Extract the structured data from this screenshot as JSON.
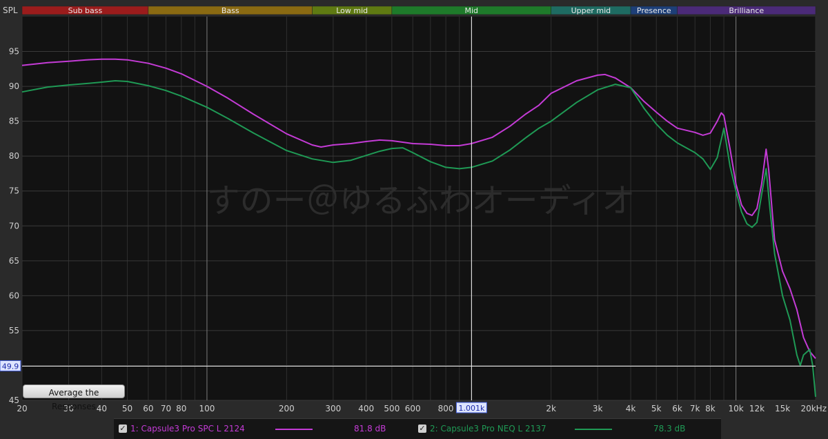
{
  "bands": [
    {
      "label": "Sub bass",
      "color": "#9b1c1c",
      "from": 20,
      "to": 60
    },
    {
      "label": "Bass",
      "color": "#8a6a12",
      "from": 60,
      "to": 250
    },
    {
      "label": "Low mid",
      "color": "#5f7a12",
      "from": 250,
      "to": 500
    },
    {
      "label": "Mid",
      "color": "#1e7a2a",
      "from": 500,
      "to": 2000
    },
    {
      "label": "Upper mid",
      "color": "#1e6b62",
      "from": 2000,
      "to": 4000
    },
    {
      "label": "Presence",
      "color": "#1d3f78",
      "from": 4000,
      "to": 6000
    },
    {
      "label": "Brilliance",
      "color": "#4b2a78",
      "from": 6000,
      "to": 20000
    }
  ],
  "chart_data": {
    "type": "line",
    "ylabel": "SPL",
    "xunit_label": "20kHz",
    "xscale": "log",
    "xlim": [
      20,
      20000
    ],
    "ylim": [
      45,
      100
    ],
    "yticks": [
      45,
      50,
      55,
      60,
      65,
      70,
      75,
      80,
      85,
      90,
      95
    ],
    "xticks": [
      {
        "v": 20,
        "t": "20"
      },
      {
        "v": 30,
        "t": "30"
      },
      {
        "v": 40,
        "t": "40"
      },
      {
        "v": 50,
        "t": "50"
      },
      {
        "v": 60,
        "t": "60"
      },
      {
        "v": 70,
        "t": "70"
      },
      {
        "v": 80,
        "t": "80"
      },
      {
        "v": 100,
        "t": "100"
      },
      {
        "v": 200,
        "t": "200"
      },
      {
        "v": 300,
        "t": "300"
      },
      {
        "v": 400,
        "t": "400"
      },
      {
        "v": 500,
        "t": "500"
      },
      {
        "v": 600,
        "t": "600"
      },
      {
        "v": 800,
        "t": "800"
      },
      {
        "v": 2000,
        "t": "2k"
      },
      {
        "v": 3000,
        "t": "3k"
      },
      {
        "v": 4000,
        "t": "4k"
      },
      {
        "v": 5000,
        "t": "5k"
      },
      {
        "v": 6000,
        "t": "6k"
      },
      {
        "v": 7000,
        "t": "7k"
      },
      {
        "v": 8000,
        "t": "8k"
      },
      {
        "v": 10000,
        "t": "10k"
      },
      {
        "v": 12000,
        "t": "12k"
      },
      {
        "v": 15000,
        "t": "15k"
      }
    ],
    "cursor": {
      "x": 1001,
      "x_label": "1.001k",
      "y": 49.9,
      "y_label": "49.9"
    },
    "watermark": "すのー＠ゆるふわオーディオ",
    "series": [
      {
        "name": "1: Capsule3 Pro SPC L 2124",
        "color": "#c43bd6",
        "level": "81.8 dB",
        "points": [
          [
            20,
            93.0
          ],
          [
            25,
            93.4
          ],
          [
            30,
            93.6
          ],
          [
            35,
            93.8
          ],
          [
            40,
            93.9
          ],
          [
            45,
            93.9
          ],
          [
            50,
            93.8
          ],
          [
            60,
            93.3
          ],
          [
            70,
            92.6
          ],
          [
            80,
            91.8
          ],
          [
            100,
            90.0
          ],
          [
            120,
            88.3
          ],
          [
            150,
            86.0
          ],
          [
            200,
            83.2
          ],
          [
            250,
            81.6
          ],
          [
            270,
            81.3
          ],
          [
            300,
            81.6
          ],
          [
            350,
            81.8
          ],
          [
            400,
            82.1
          ],
          [
            450,
            82.3
          ],
          [
            500,
            82.2
          ],
          [
            550,
            82.0
          ],
          [
            600,
            81.8
          ],
          [
            700,
            81.7
          ],
          [
            800,
            81.5
          ],
          [
            900,
            81.5
          ],
          [
            1000,
            81.8
          ],
          [
            1200,
            82.7
          ],
          [
            1400,
            84.3
          ],
          [
            1600,
            86.0
          ],
          [
            1800,
            87.3
          ],
          [
            2000,
            89.0
          ],
          [
            2500,
            90.8
          ],
          [
            3000,
            91.6
          ],
          [
            3200,
            91.7
          ],
          [
            3500,
            91.2
          ],
          [
            4000,
            89.8
          ],
          [
            4500,
            87.8
          ],
          [
            5000,
            86.3
          ],
          [
            5500,
            85.0
          ],
          [
            6000,
            84.0
          ],
          [
            7000,
            83.4
          ],
          [
            7500,
            83.0
          ],
          [
            8000,
            83.3
          ],
          [
            8500,
            85.0
          ],
          [
            8800,
            86.2
          ],
          [
            9000,
            85.8
          ],
          [
            9500,
            81.0
          ],
          [
            10000,
            76.0
          ],
          [
            10500,
            73.0
          ],
          [
            11000,
            71.8
          ],
          [
            11500,
            71.5
          ],
          [
            12000,
            72.5
          ],
          [
            12500,
            76.0
          ],
          [
            13000,
            81.0
          ],
          [
            13300,
            78.0
          ],
          [
            14000,
            68.0
          ],
          [
            15000,
            63.5
          ],
          [
            16000,
            61.0
          ],
          [
            17000,
            58.0
          ],
          [
            18000,
            54.0
          ],
          [
            19000,
            52.0
          ],
          [
            20000,
            51.0
          ]
        ]
      },
      {
        "name": "2: Capsule3 Pro NEQ L 2137",
        "color": "#1f9a55",
        "level": "78.3 dB",
        "points": [
          [
            20,
            89.2
          ],
          [
            25,
            89.9
          ],
          [
            30,
            90.2
          ],
          [
            35,
            90.4
          ],
          [
            40,
            90.6
          ],
          [
            45,
            90.8
          ],
          [
            50,
            90.7
          ],
          [
            60,
            90.1
          ],
          [
            70,
            89.4
          ],
          [
            80,
            88.6
          ],
          [
            100,
            87.0
          ],
          [
            120,
            85.4
          ],
          [
            150,
            83.3
          ],
          [
            200,
            80.8
          ],
          [
            250,
            79.6
          ],
          [
            300,
            79.1
          ],
          [
            350,
            79.4
          ],
          [
            400,
            80.1
          ],
          [
            450,
            80.7
          ],
          [
            500,
            81.1
          ],
          [
            550,
            81.2
          ],
          [
            600,
            80.5
          ],
          [
            700,
            79.2
          ],
          [
            800,
            78.4
          ],
          [
            900,
            78.2
          ],
          [
            1000,
            78.4
          ],
          [
            1200,
            79.3
          ],
          [
            1400,
            80.9
          ],
          [
            1600,
            82.6
          ],
          [
            1800,
            84.0
          ],
          [
            2000,
            85.0
          ],
          [
            2500,
            87.7
          ],
          [
            3000,
            89.5
          ],
          [
            3500,
            90.3
          ],
          [
            4000,
            89.8
          ],
          [
            4500,
            86.8
          ],
          [
            5000,
            84.6
          ],
          [
            5500,
            83.0
          ],
          [
            6000,
            81.9
          ],
          [
            7000,
            80.5
          ],
          [
            7500,
            79.6
          ],
          [
            8000,
            78.1
          ],
          [
            8500,
            79.8
          ],
          [
            9000,
            84.0
          ],
          [
            9500,
            78.5
          ],
          [
            10000,
            75.0
          ],
          [
            10500,
            72.0
          ],
          [
            11000,
            70.3
          ],
          [
            11500,
            69.8
          ],
          [
            12000,
            70.5
          ],
          [
            12500,
            74.5
          ],
          [
            13000,
            78.2
          ],
          [
            13400,
            73.0
          ],
          [
            14000,
            66.0
          ],
          [
            15000,
            60.0
          ],
          [
            16000,
            56.5
          ],
          [
            17000,
            51.5
          ],
          [
            17500,
            50.0
          ],
          [
            18000,
            51.5
          ],
          [
            19000,
            52.3
          ],
          [
            19500,
            50.0
          ],
          [
            20000,
            45.5
          ]
        ]
      }
    ]
  },
  "controls": {
    "average_button": "Average the Responses"
  },
  "legend": {
    "check_glyph": "✓"
  }
}
